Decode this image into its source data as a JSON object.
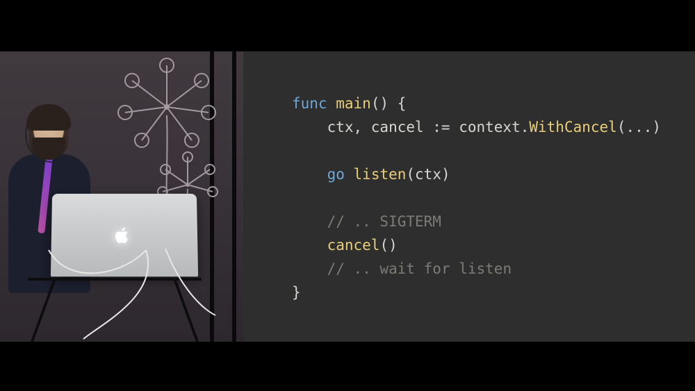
{
  "code": {
    "lines": [
      {
        "segments": [
          {
            "cls": "kw",
            "text": "func"
          },
          {
            "cls": "",
            "text": " "
          },
          {
            "cls": "fn",
            "text": "main"
          },
          {
            "cls": "",
            "text": "() {"
          }
        ]
      },
      {
        "segments": [
          {
            "cls": "",
            "text": "    ctx, cancel := context."
          },
          {
            "cls": "fn",
            "text": "WithCancel"
          },
          {
            "cls": "",
            "text": "(...)"
          }
        ]
      },
      {
        "segments": [
          {
            "cls": "",
            "text": ""
          }
        ]
      },
      {
        "segments": [
          {
            "cls": "",
            "text": "    "
          },
          {
            "cls": "kw",
            "text": "go"
          },
          {
            "cls": "",
            "text": " "
          },
          {
            "cls": "fn",
            "text": "listen"
          },
          {
            "cls": "",
            "text": "(ctx)"
          }
        ]
      },
      {
        "segments": [
          {
            "cls": "",
            "text": ""
          }
        ]
      },
      {
        "segments": [
          {
            "cls": "",
            "text": "    "
          },
          {
            "cls": "cmnt",
            "text": "// .. SIGTERM"
          }
        ]
      },
      {
        "segments": [
          {
            "cls": "",
            "text": "    "
          },
          {
            "cls": "fn",
            "text": "cancel"
          },
          {
            "cls": "",
            "text": "()"
          }
        ]
      },
      {
        "segments": [
          {
            "cls": "",
            "text": "    "
          },
          {
            "cls": "cmnt",
            "text": "// .. wait for listen"
          }
        ]
      },
      {
        "segments": [
          {
            "cls": "",
            "text": "}"
          }
        ]
      }
    ]
  }
}
